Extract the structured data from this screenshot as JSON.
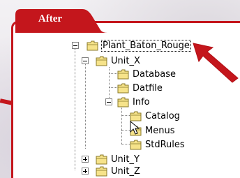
{
  "tab": {
    "label": "After"
  },
  "tree": {
    "root": "Plant_Baton_Rouge",
    "unit_x": "Unit_X",
    "database": "Database",
    "datfile": "Datfile",
    "info": "Info",
    "catalog": "Catalog",
    "menus": "Menus",
    "stdrules": "StdRules",
    "unit_y": "Unit_Y",
    "unit_z": "Unit_Z"
  },
  "colors": {
    "accent": "#c4161c",
    "folder": "#f6e38a"
  },
  "icons": [
    "folder-icon",
    "folder-open-icon",
    "expand-icon",
    "collapse-icon",
    "pointer-cursor-icon",
    "arrow-icon"
  ]
}
